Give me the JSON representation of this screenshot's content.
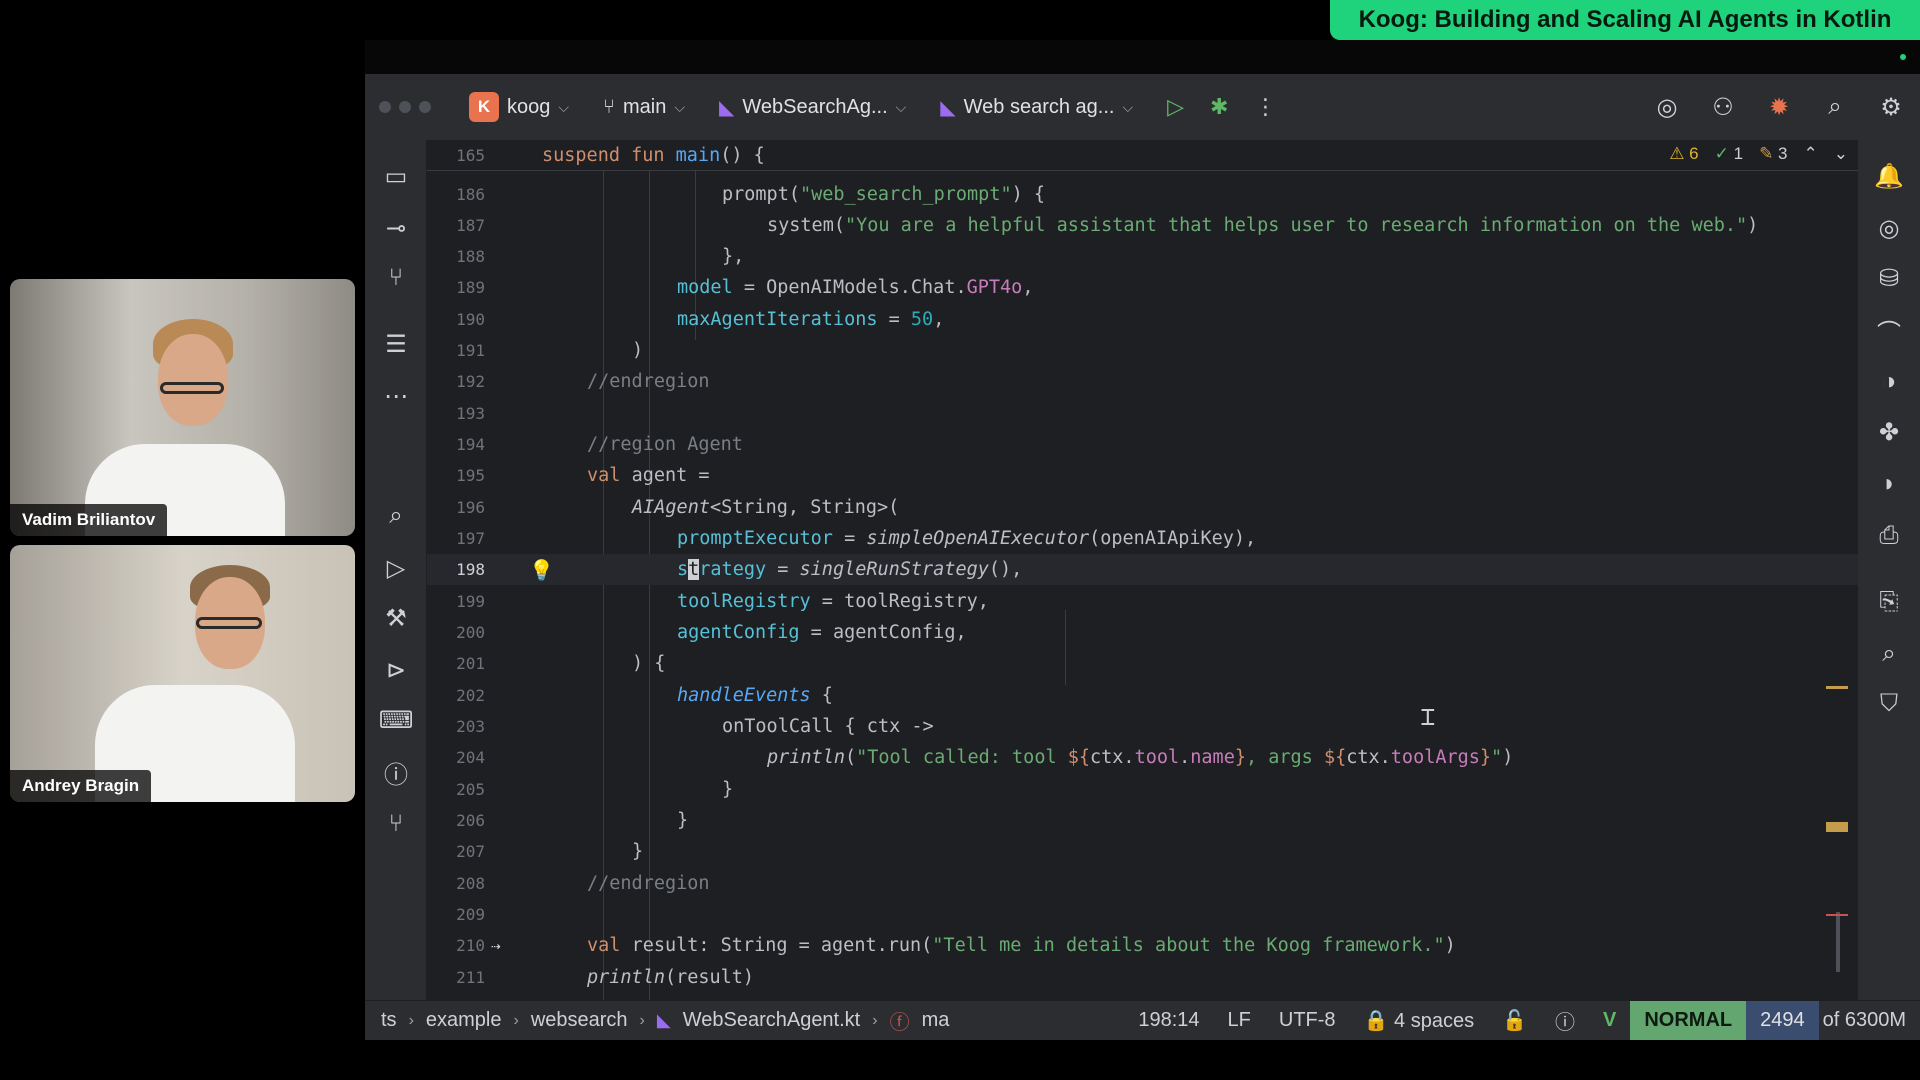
{
  "banner": {
    "title": "Koog: Building and Scaling AI Agents in Kotlin"
  },
  "participants": [
    {
      "name": "Vadim Briliantov"
    },
    {
      "name": "Andrey Bragin"
    }
  ],
  "titlebar": {
    "project_badge": "K",
    "project": "koog",
    "branch": "main",
    "file_tab": "WebSearchAg...",
    "run_config": "Web search ag..."
  },
  "inspections": {
    "warnings": "6",
    "checks": "1",
    "typos": "3"
  },
  "editor": {
    "sticky_line_number": "165",
    "lines": [
      {
        "n": "186",
        "text": ""
      },
      {
        "n": "187",
        "text": ""
      },
      {
        "n": "188",
        "text": ""
      },
      {
        "n": "189",
        "text": ""
      },
      {
        "n": "190",
        "text": ""
      },
      {
        "n": "191",
        "text": ""
      },
      {
        "n": "192",
        "text": ""
      },
      {
        "n": "193",
        "text": ""
      },
      {
        "n": "194",
        "text": ""
      },
      {
        "n": "195",
        "text": ""
      },
      {
        "n": "196",
        "text": ""
      },
      {
        "n": "197",
        "text": ""
      },
      {
        "n": "198",
        "text": ""
      },
      {
        "n": "199",
        "text": ""
      },
      {
        "n": "200",
        "text": ""
      },
      {
        "n": "201",
        "text": ""
      },
      {
        "n": "202",
        "text": ""
      },
      {
        "n": "203",
        "text": ""
      },
      {
        "n": "204",
        "text": ""
      },
      {
        "n": "205",
        "text": ""
      },
      {
        "n": "206",
        "text": ""
      },
      {
        "n": "207",
        "text": ""
      },
      {
        "n": "208",
        "text": ""
      },
      {
        "n": "209",
        "text": ""
      },
      {
        "n": "210",
        "text": ""
      },
      {
        "n": "211",
        "text": ""
      }
    ],
    "code": {
      "l165a": "suspend fun ",
      "l165b": "main",
      "l165c": "() {",
      "l186a": "prompt(",
      "l186b": "\"web_search_prompt\"",
      "l186c": ") {",
      "l187a": "system(",
      "l187b": "\"You are a helpful assistant that helps user to research information on the web.\"",
      "l187c": ")",
      "l188": "},",
      "l189a": "model",
      "l189b": " = OpenAIModels.Chat.",
      "l189c": "GPT4o",
      "l189d": ",",
      "l190a": "maxAgentIterations",
      "l190b": " = ",
      "l190c": "50",
      "l190d": ",",
      "l191": ")",
      "l192": "//endregion",
      "l194": "//region Agent",
      "l195a": "val ",
      "l195b": "agent =",
      "l196a": "AIAgent",
      "l196b": "<String, String>(",
      "l197a": "promptExecutor",
      "l197b": " = ",
      "l197c": "simpleOpenAIExecutor",
      "l197d": "(openAIApiKey),",
      "l198a": "s",
      "l198b": "t",
      "l198c": "rategy",
      "l198d": " = ",
      "l198e": "singleRunStrategy",
      "l198f": "(),",
      "l199a": "toolRegistry",
      "l199b": " = toolRegistry,",
      "l200a": "agentConfig",
      "l200b": " = agentConfig,",
      "l201": ") {",
      "l202a": "handleEvents",
      "l202b": " {",
      "l203a": "onToolCall",
      "l203b": " { ctx ->",
      "l204a": "println",
      "l204b": "(",
      "l204c": "\"Tool called: tool ",
      "l204d": "${",
      "l204e": "ctx.",
      "l204f": "tool",
      "l204g": ".",
      "l204h": "name",
      "l204i": "}",
      "l204j": ", args ",
      "l204k": "${",
      "l204l": "ctx.",
      "l204m": "toolArgs",
      "l204n": "}",
      "l204o": "\"",
      "l204p": ")",
      "l205": "}",
      "l206": "}",
      "l207": "}",
      "l208": "//endregion",
      "l210a": "val ",
      "l210b": "result: String = agent.run(",
      "l210c": "\"Tell me in details about the Koog framework.\"",
      "l210d": ")",
      "l211a": "println",
      "l211b": "(result)"
    }
  },
  "statusbar": {
    "crumbs": [
      "ts",
      "example",
      "websearch",
      "WebSearchAgent.kt",
      "ma"
    ],
    "position": "198:14",
    "line_ending": "LF",
    "encoding": "UTF-8",
    "indent": "4 spaces",
    "vim_mode": "NORMAL",
    "memory_used": "2494",
    "memory_total": "of 6300M"
  }
}
